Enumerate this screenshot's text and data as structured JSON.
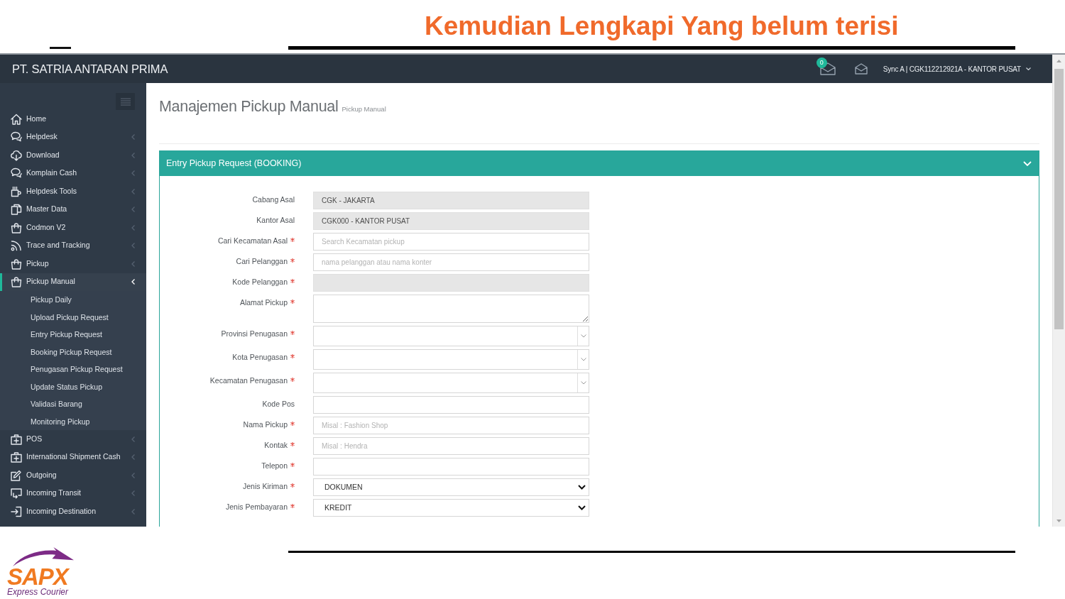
{
  "slide": {
    "title": "Kemudian Lengkapi Yang belum terisi"
  },
  "app": {
    "brand": "PT. SATRIA ANTARAN PRIMA",
    "notification_count": "0",
    "user": "Sync A | CGK112212921A - KANTOR PUSAT"
  },
  "sidebar": {
    "items": [
      {
        "label": "Home",
        "kind": "link",
        "selected": false
      },
      {
        "label": "Helpdesk",
        "kind": "submenu",
        "selected": false,
        "expanded": false
      },
      {
        "label": "Download",
        "kind": "submenu",
        "selected": false,
        "expanded": false
      },
      {
        "label": "Komplain Cash",
        "kind": "submenu",
        "selected": false,
        "expanded": false
      },
      {
        "label": "Helpdesk Tools",
        "kind": "submenu",
        "selected": false,
        "expanded": false
      },
      {
        "label": "Master Data",
        "kind": "submenu",
        "selected": false,
        "expanded": false
      },
      {
        "label": "Codmon V2",
        "kind": "submenu",
        "selected": false,
        "expanded": false
      },
      {
        "label": "Trace and Tracking",
        "kind": "submenu",
        "selected": false,
        "expanded": false
      },
      {
        "label": "Pickup",
        "kind": "submenu",
        "selected": false,
        "expanded": false
      },
      {
        "label": "Pickup Manual",
        "kind": "submenu",
        "selected": true,
        "expanded": true,
        "children": [
          {
            "label": "Pickup Daily",
            "selected": false
          },
          {
            "label": "Upload Pickup Request",
            "selected": false
          },
          {
            "label": "Entry Pickup Request",
            "selected": false
          },
          {
            "label": "Booking Pickup Request",
            "selected": false
          },
          {
            "label": "Penugasan Pickup Request",
            "selected": false
          },
          {
            "label": "Update Status Pickup",
            "selected": false
          },
          {
            "label": "Validasi Barang",
            "selected": false
          },
          {
            "label": "Monitoring Pickup",
            "selected": false
          }
        ]
      },
      {
        "label": "POS",
        "kind": "submenu",
        "selected": false,
        "expanded": false
      },
      {
        "label": "International Shipment Cash",
        "kind": "submenu",
        "selected": false,
        "expanded": false
      },
      {
        "label": "Outgoing",
        "kind": "submenu",
        "selected": false,
        "expanded": false
      },
      {
        "label": "Incoming Transit",
        "kind": "submenu",
        "selected": false,
        "expanded": false
      },
      {
        "label": "Incoming Destination",
        "kind": "submenu",
        "selected": false,
        "expanded": false
      }
    ]
  },
  "page": {
    "title": "Manajemen Pickup Manual",
    "subtitle": "Pickup Manual"
  },
  "panel": {
    "title": "Entry Pickup Request (BOOKING)",
    "fields": [
      {
        "label": "Cabang Asal",
        "required": false,
        "kind": "input",
        "readonly": true,
        "value": "CGK - JAKARTA"
      },
      {
        "label": "Kantor Asal",
        "required": false,
        "kind": "input",
        "readonly": true,
        "value": "CGK000 - KANTOR PUSAT"
      },
      {
        "label": "Cari Kecamatan Asal",
        "required": true,
        "kind": "input",
        "readonly": false,
        "placeholder": "Search Kecamatan pickup"
      },
      {
        "label": "Cari Pelanggan",
        "required": true,
        "kind": "input",
        "readonly": false,
        "placeholder": "nama pelanggan atau nama konter"
      },
      {
        "label": "Kode Pelanggan",
        "required": true,
        "kind": "input",
        "readonly": true
      },
      {
        "label": "Alamat Pickup",
        "required": true,
        "kind": "textarea",
        "readonly": false
      },
      {
        "label": "Provinsi Penugasan",
        "required": true,
        "kind": "search-select",
        "readonly": false
      },
      {
        "label": "Kota Penugasan",
        "required": true,
        "kind": "search-select",
        "readonly": false
      },
      {
        "label": "Kecamatan Penugasan",
        "required": true,
        "kind": "search-select",
        "readonly": false
      },
      {
        "label": "Kode Pos",
        "required": false,
        "kind": "input",
        "readonly": false
      },
      {
        "label": "Nama Pickup",
        "required": true,
        "kind": "input",
        "readonly": false,
        "placeholder": "Misal : Fashion Shop"
      },
      {
        "label": "Kontak",
        "required": true,
        "kind": "input",
        "readonly": false,
        "placeholder": "Misal : Hendra"
      },
      {
        "label": "Telepon",
        "required": true,
        "kind": "input",
        "readonly": false
      },
      {
        "label": "Jenis Kiriman",
        "required": true,
        "kind": "select",
        "readonly": false,
        "value": "DOKUMEN"
      },
      {
        "label": "Jenis Pembayaran",
        "required": true,
        "kind": "select",
        "readonly": false,
        "value": "KREDIT"
      }
    ]
  },
  "logo": {
    "wordmark": "SAPX",
    "tagline": "Express Courier"
  }
}
